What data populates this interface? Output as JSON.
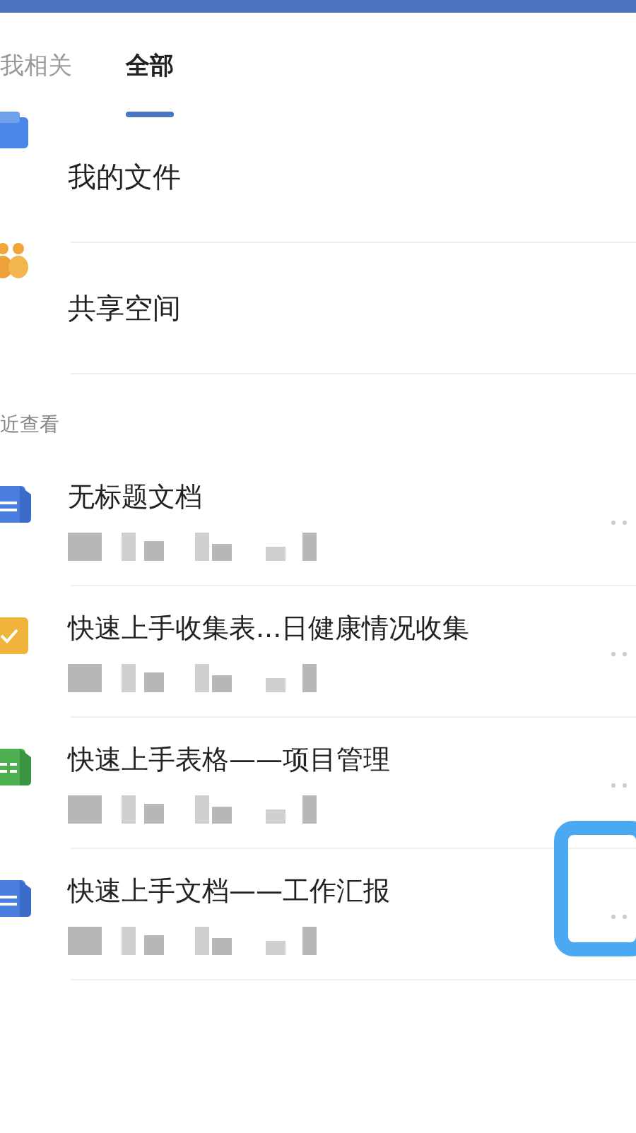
{
  "tabs": [
    {
      "label": "我相关",
      "selected": false
    },
    {
      "label": "全部",
      "selected": true
    }
  ],
  "places": [
    {
      "kind": "folder",
      "label": "我的文件"
    },
    {
      "kind": "shared",
      "label": "共享空间"
    }
  ],
  "section_title": "近查看",
  "recent": [
    {
      "kind": "doc",
      "title": "无标题文档",
      "highlighted": false
    },
    {
      "kind": "form",
      "title": "快速上手收集表...日健康情况收集",
      "highlighted": false
    },
    {
      "kind": "sheet",
      "title": "快速上手表格——项目管理",
      "highlighted": false
    },
    {
      "kind": "doc",
      "title": "快速上手文档——工作汇报",
      "highlighted": true
    }
  ]
}
